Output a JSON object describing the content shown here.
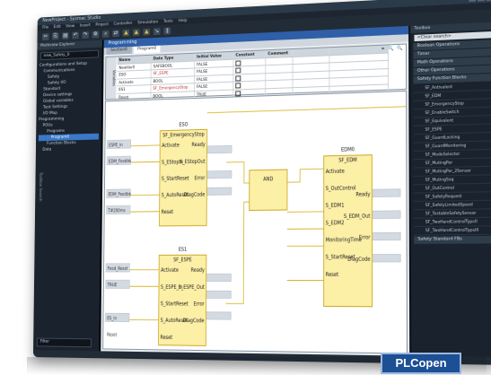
{
  "window": {
    "title": "NewProject - Sysmac Studio"
  },
  "menu": [
    "File",
    "Edit",
    "View",
    "Insert",
    "Project",
    "Controller",
    "Simulation",
    "Tools",
    "Help"
  ],
  "left_pane": {
    "header": "Multiview Explorer",
    "device": "new_Safety_0",
    "tree": [
      {
        "label": "Configurations and Setup",
        "level": 0
      },
      {
        "label": "Communications",
        "level": 1
      },
      {
        "label": "Safety",
        "level": 2
      },
      {
        "label": "Safety I/O",
        "level": 2
      },
      {
        "label": "Standard",
        "level": 1
      },
      {
        "label": "Device settings",
        "level": 1
      },
      {
        "label": "Global variables",
        "level": 1
      },
      {
        "label": "Task Settings",
        "level": 1
      },
      {
        "label": "I/O Map",
        "level": 1
      },
      {
        "label": "Programming",
        "level": 0
      },
      {
        "label": "POUs",
        "level": 1
      },
      {
        "label": "Programs",
        "level": 2
      },
      {
        "label": "Program0",
        "level": 3,
        "selected": true
      },
      {
        "label": "Function Blocks",
        "level": 2
      },
      {
        "label": "Data",
        "level": 1
      }
    ],
    "side_label": "Toolbox Search",
    "filter": "Filter"
  },
  "editor": {
    "title": "Programming",
    "tabs": [
      "Section0",
      "Program0"
    ],
    "side_label": "Variables",
    "tools": "⌗ 🔍 🔍",
    "columns": [
      "Name",
      "Data Type",
      "Initial Value",
      "Constant",
      "Comment"
    ],
    "variables": [
      {
        "name": "NewVar0",
        "type": "SAFEBOOL",
        "init": "FALSE"
      },
      {
        "name": "ESO",
        "type": "SF_ESPE",
        "init": "FALSE"
      },
      {
        "name": "Activate",
        "type": "BOOL",
        "init": "FALSE"
      },
      {
        "name": "ES1",
        "type": "SF_EmergencyStop",
        "init": "FALSE"
      },
      {
        "name": "Reset",
        "type": "BOOL",
        "init": "TRUE"
      }
    ]
  },
  "diagram": {
    "blocks": [
      {
        "instance": "ESO",
        "type": "SF_EmergencyStop",
        "inputs": [
          "Activate",
          "S_EStopIn",
          "S_StartReset",
          "S_AutoReset",
          "Reset"
        ],
        "outputs": [
          "Ready",
          "S_EStopOut",
          "Error",
          "DiagCode"
        ]
      },
      {
        "instance": "AND",
        "type": "AND",
        "inputs": [],
        "outputs": []
      },
      {
        "instance": "EDM0",
        "type": "SF_EDM",
        "inputs": [
          "Activate",
          "S_OutControl",
          "S_EDM1",
          "S_EDM2",
          "MonitoringTime",
          "S_StartReset",
          "Reset"
        ],
        "outputs": [
          "Ready",
          "S_EDM_Out",
          "Error",
          "DiagCode"
        ]
      },
      {
        "instance": "ES1",
        "type": "SF_ESPE",
        "inputs": [
          "Activate",
          "S_ESPE_In",
          "S_StartReset",
          "S_AutoReset",
          "Reset"
        ],
        "outputs": [
          "Ready",
          "S_ESPE_Out",
          "Error",
          "DiagCode"
        ]
      }
    ],
    "input_labels": [
      "ESPE_in",
      "EDM_Feedbk",
      "EDM_Feedbk",
      "T#200ms",
      "Feed_Reset",
      "TRUE",
      "ES_in",
      "Reset"
    ]
  },
  "right_pane": {
    "header": "Toolbox",
    "search": "<Clear search>",
    "sections": [
      "Boolean Operations",
      "Timer",
      "Math Operations",
      "Other Operations",
      "Safety Function Blocks"
    ],
    "items": [
      "SF_Antivalent",
      "SF_EDM",
      "SF_EmergencyStop",
      "SF_EnableSwitch",
      "SF_Equivalent",
      "SF_ESPE",
      "SF_GuardLocking",
      "SF_GuardMonitoring",
      "SF_ModeSelector",
      "SF_MutingPar",
      "SF_MutingPar_2Sensor",
      "SF_MutingSeq",
      "SF_OutControl",
      "SF_SafetyRequest",
      "SF_SafelyLimitedSpeed",
      "SF_TestableSafetySensor",
      "SF_TwoHandControlTypeII",
      "SF_TwoHandControlTypeIII"
    ],
    "footer": "Safety Standard FBs"
  },
  "logo": {
    "text": "PLCopen"
  },
  "colors": {
    "block_fill": "#fcefa6",
    "block_border": "#c9a41a",
    "wire": "#d8b42a",
    "selection": "#3a78c8",
    "tab_blue": "#2e5fa8"
  }
}
